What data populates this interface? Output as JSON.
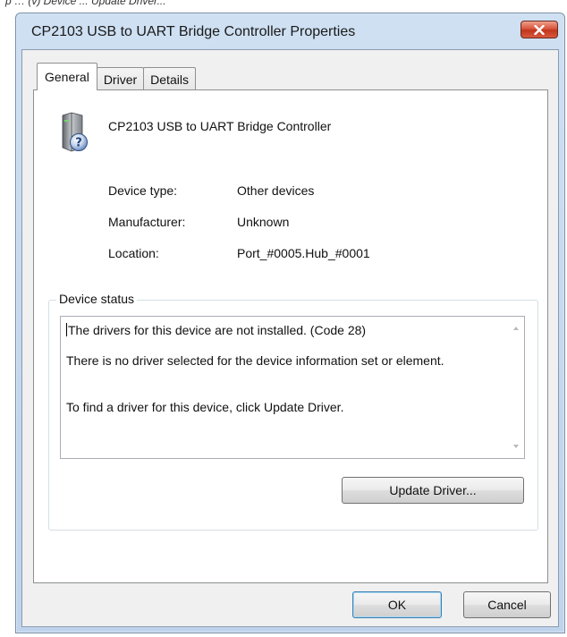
{
  "top_strip_text": "p … (v) Device ... Update Driver...",
  "window": {
    "title": "CP2103 USB to UART Bridge Controller Properties"
  },
  "tabs": [
    {
      "label": "General",
      "active": true
    },
    {
      "label": "Driver",
      "active": false
    },
    {
      "label": "Details",
      "active": false
    }
  ],
  "device": {
    "icon": "unknown-device-icon",
    "name": "CP2103 USB to UART Bridge Controller"
  },
  "properties": [
    {
      "label": "Device type:",
      "value": "Other devices"
    },
    {
      "label": "Manufacturer:",
      "value": "Unknown"
    },
    {
      "label": "Location:",
      "value": "Port_#0005.Hub_#0001"
    }
  ],
  "device_status": {
    "legend": "Device status",
    "lines": [
      "The drivers for this device are not installed. (Code 28)",
      "There is no driver selected for the device information set or element.",
      "To find a driver for this device, click Update Driver."
    ],
    "update_button_label": "Update Driver..."
  },
  "footer": {
    "ok_label": "OK",
    "cancel_label": "Cancel"
  },
  "colors": {
    "title_bar": "#c3d7ee",
    "close_button": "#c1361c",
    "dialog_face": "#f0f0f0"
  }
}
